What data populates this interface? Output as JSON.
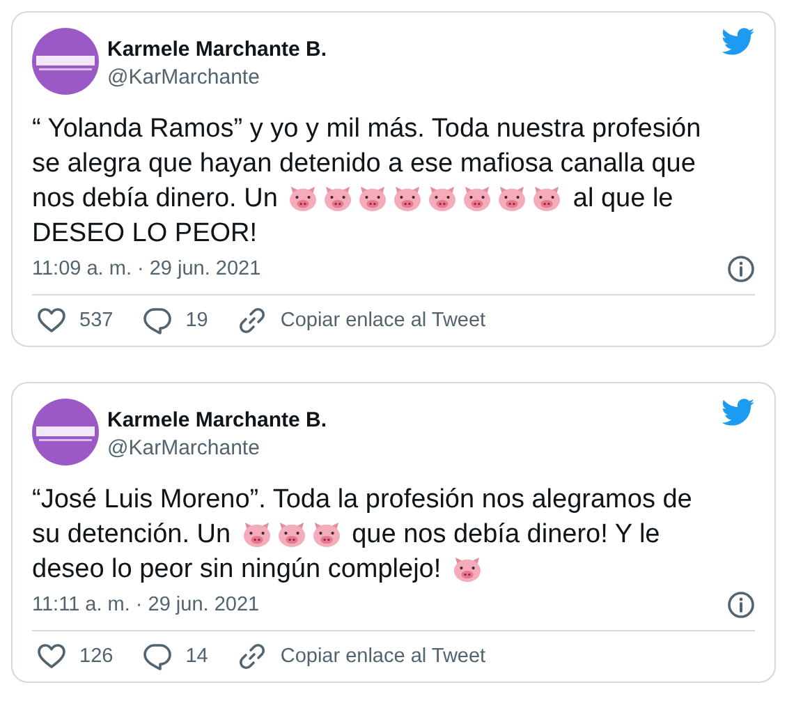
{
  "tweets": [
    {
      "author": {
        "name": "Karmele Marchante B.",
        "handle": "@KarMarchante"
      },
      "lines": [
        [
          {
            "kind": "text",
            "text": "“ Yolanda Ramos” y yo y mil más. Toda nuestra profesión"
          }
        ],
        [
          {
            "kind": "text",
            "text": "se alegra que hayan detenido a ese mafiosa canalla que"
          }
        ],
        [
          {
            "kind": "text",
            "text": "nos debía dinero. Un"
          },
          {
            "kind": "pig"
          },
          {
            "kind": "pig"
          },
          {
            "kind": "pig"
          },
          {
            "kind": "pig"
          },
          {
            "kind": "pig"
          },
          {
            "kind": "pig"
          },
          {
            "kind": "pig"
          },
          {
            "kind": "pig"
          },
          {
            "kind": "text",
            "text": "al que le"
          }
        ],
        [
          {
            "kind": "text",
            "text": "DESEO LO PEOR!"
          }
        ]
      ],
      "timestamp": "11:09 a. m. · 29 jun. 2021",
      "likes": "537",
      "replies": "19",
      "copy_link": "Copiar enlace al Tweet"
    },
    {
      "author": {
        "name": "Karmele Marchante B.",
        "handle": "@KarMarchante"
      },
      "lines": [
        [
          {
            "kind": "text",
            "text": "“José Luis Moreno”. Toda la profesión nos alegramos de"
          }
        ],
        [
          {
            "kind": "text",
            "text": "su detención. Un"
          },
          {
            "kind": "pig"
          },
          {
            "kind": "pig"
          },
          {
            "kind": "pig"
          },
          {
            "kind": "text",
            "text": "que nos debía dinero! Y le"
          }
        ],
        [
          {
            "kind": "text",
            "text": "deseo lo peor sin ningún complejo!"
          },
          {
            "kind": "pig"
          }
        ]
      ],
      "timestamp": "11:11 a. m. · 29 jun. 2021",
      "likes": "126",
      "replies": "14",
      "copy_link": "Copiar enlace al Tweet"
    }
  ]
}
